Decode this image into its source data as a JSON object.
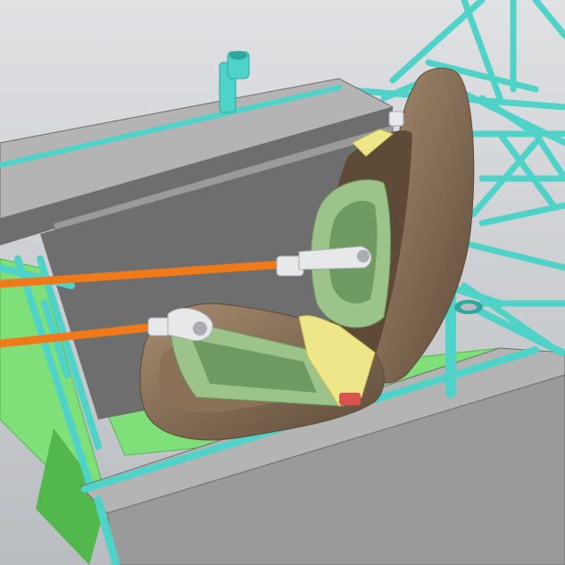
{
  "scene": {
    "subject": "cad-model-racing-seat-in-tube-frame-chassis",
    "colors": {
      "background_top": "#dfe1e3",
      "background_bottom": "#b9bcc0",
      "frame_tube": "#4fd3c8",
      "frame_tube_dark": "#2fa79e",
      "floor_panel": "#7fe07a",
      "floor_panel_dark": "#52b84e",
      "side_panel": "#9a9a9a",
      "side_panel_light": "#b4b4b4",
      "side_panel_dark": "#6e6e6e",
      "seat_shell": "#8a7158",
      "seat_shell_dark": "#5e4a37",
      "seat_shell_light": "#a78d72",
      "seat_bracket": "#9cc48a",
      "seat_bracket_dark": "#6f9a62",
      "harness": "#efe68a",
      "harness_dark": "#c8bd58",
      "harness_accent": "#d9534f",
      "rod": "#f07a1a",
      "rod_dark": "#b8550a",
      "rod_end": "#e6e8ea",
      "rod_end_dark": "#a9adb1"
    }
  }
}
